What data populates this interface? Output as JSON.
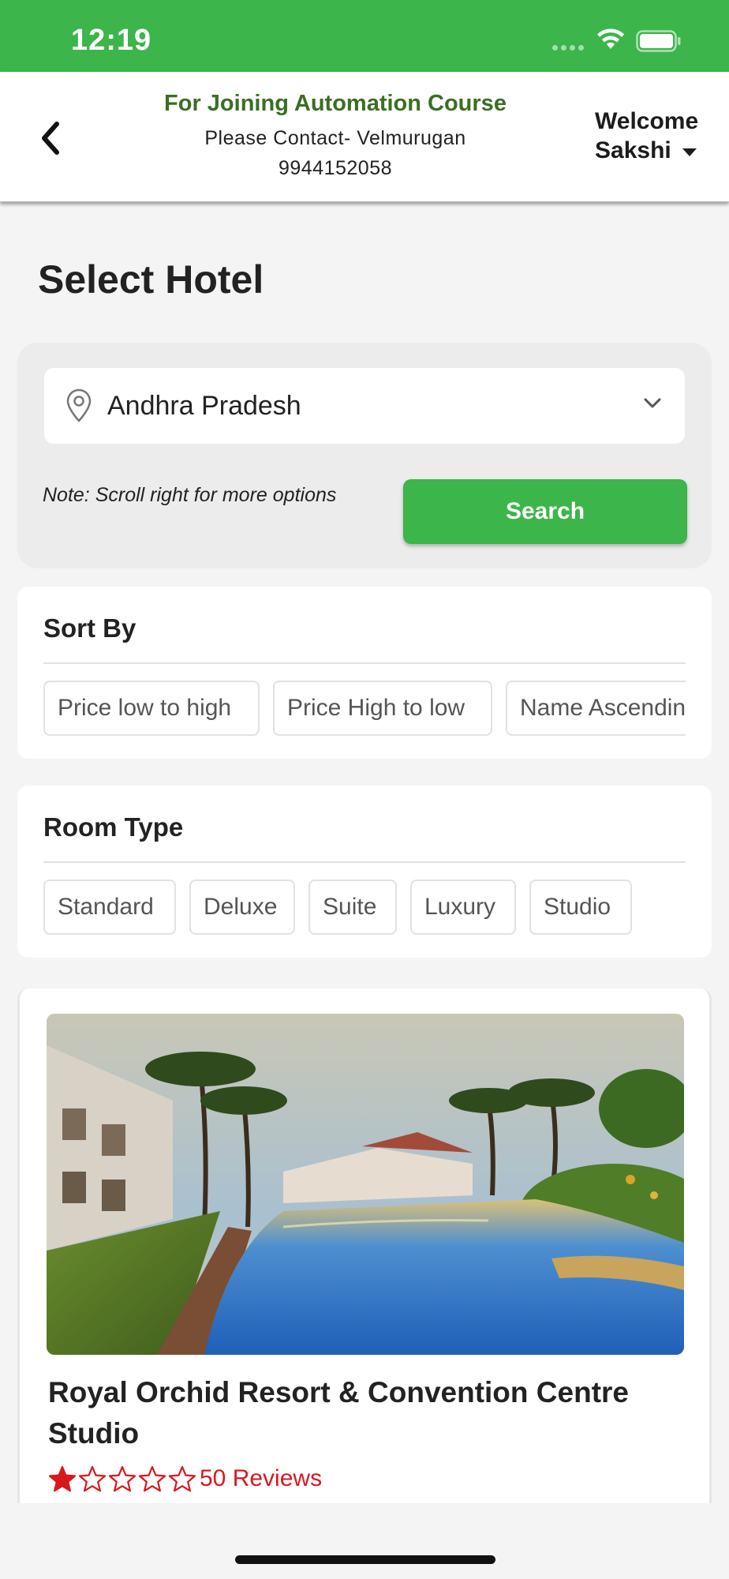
{
  "status_bar": {
    "time": "12:19",
    "color": "#3cb54a",
    "icons": [
      "cellular-dots-icon",
      "wifi-icon",
      "battery-icon"
    ]
  },
  "header": {
    "title": "For Joining Automation Course",
    "contact_line": "Please Contact- Velmurugan",
    "phone": "9944152058",
    "welcome_label": "Welcome",
    "user_name": "Sakshi",
    "back_icon": "chevron-left-icon",
    "title_color": "#3a6f22"
  },
  "page": {
    "title": "Select Hotel"
  },
  "search": {
    "location_value": "Andhra Pradesh",
    "location_icon": "map-pin-icon",
    "note": "Note: Scroll right for more options",
    "button_label": "Search",
    "accent": "#3cb54a"
  },
  "sort_by": {
    "heading": "Sort By",
    "options": [
      "Price low to high",
      "Price High to low",
      "Name Ascending"
    ]
  },
  "room_type": {
    "heading": "Room Type",
    "options": [
      "Standard",
      "Deluxe",
      "Suite",
      "Luxury",
      "Studio"
    ]
  },
  "hotel": {
    "name": "Royal Orchid Resort & Convention Centre Studio",
    "rating": 1,
    "rating_max": 5,
    "reviews": "50 Reviews",
    "star_color": "#d9181e"
  }
}
